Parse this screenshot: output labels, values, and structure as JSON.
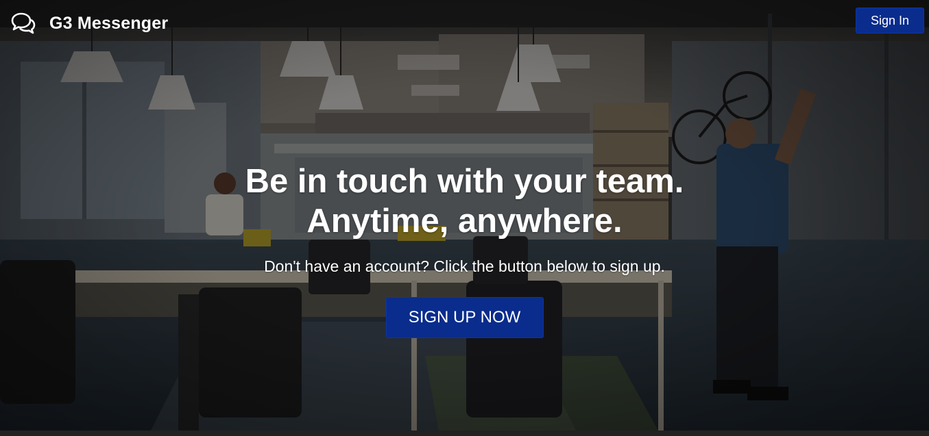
{
  "app": {
    "brand_name": "G3 Messenger",
    "brand_icon": "chat-bubbles-icon"
  },
  "navbar": {
    "signin_label": "Sign In"
  },
  "hero": {
    "headline_line1": "Be in touch with your team.",
    "headline_line2": "Anytime, anywhere.",
    "subline": "Don't have an account? Click the button below to sign up.",
    "cta_label": "SIGN UP NOW",
    "background_image": "office-photo-background"
  },
  "colors": {
    "primary_button": "#0a2c8c",
    "text": "#ffffff",
    "overlay": "#1c1c1c"
  }
}
